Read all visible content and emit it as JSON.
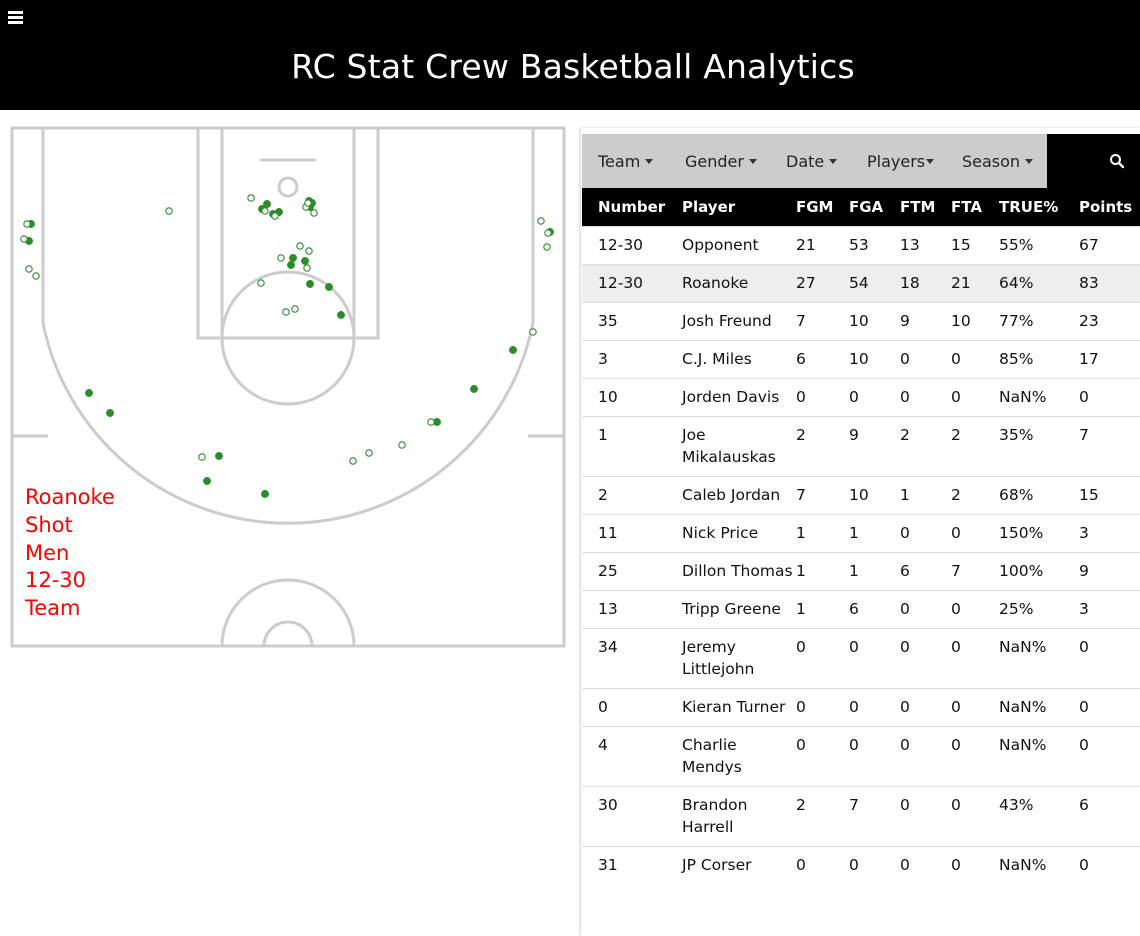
{
  "header": {
    "title": "RC Stat Crew Basketball Analytics",
    "menu_icon": "hamburger-icon"
  },
  "court": {
    "label_lines": [
      "Roanoke",
      "Shot",
      "Men",
      "12-30",
      "Team"
    ],
    "label_color": "#ff0000",
    "shot_color": "#2a8c2a",
    "line_color": "#cccccc"
  },
  "filters": {
    "items": [
      {
        "label": "Team"
      },
      {
        "label": "Gender"
      },
      {
        "label": "Date"
      },
      {
        "label": "Players"
      },
      {
        "label": "Season"
      }
    ],
    "search_icon": "search-icon"
  },
  "table": {
    "columns": [
      "Number",
      "Player",
      "FGM",
      "FGA",
      "FTM",
      "FTA",
      "TRUE%",
      "Points"
    ],
    "rows": [
      [
        "12-30",
        "Opponent",
        "21",
        "53",
        "13",
        "15",
        "55%",
        "67"
      ],
      [
        "12-30",
        "Roanoke",
        "27",
        "54",
        "18",
        "21",
        "64%",
        "83"
      ],
      [
        "35",
        "Josh Freund",
        "7",
        "10",
        "9",
        "10",
        "77%",
        "23"
      ],
      [
        "3",
        "C.J. Miles",
        "6",
        "10",
        "0",
        "0",
        "85%",
        "17"
      ],
      [
        "10",
        "Jorden Davis",
        "0",
        "0",
        "0",
        "0",
        "NaN%",
        "0"
      ],
      [
        "1",
        "Joe Mikalauskas",
        "2",
        "9",
        "2",
        "2",
        "35%",
        "7"
      ],
      [
        "2",
        "Caleb Jordan",
        "7",
        "10",
        "1",
        "2",
        "68%",
        "15"
      ],
      [
        "11",
        "Nick Price",
        "1",
        "1",
        "0",
        "0",
        "150%",
        "3"
      ],
      [
        "25",
        "Dillon Thomas",
        "1",
        "1",
        "6",
        "7",
        "100%",
        "9"
      ],
      [
        "13",
        "Tripp Greene",
        "1",
        "6",
        "0",
        "0",
        "25%",
        "3"
      ],
      [
        "34",
        "Jeremy Littlejohn",
        "0",
        "0",
        "0",
        "0",
        "NaN%",
        "0"
      ],
      [
        "0",
        "Kieran Turner",
        "0",
        "0",
        "0",
        "0",
        "NaN%",
        "0"
      ],
      [
        "4",
        "Charlie Mendys",
        "0",
        "0",
        "0",
        "0",
        "NaN%",
        "0"
      ],
      [
        "30",
        "Brandon Harrell",
        "2",
        "7",
        "0",
        "0",
        "43%",
        "6"
      ],
      [
        "31",
        "JP Corser",
        "0",
        "0",
        "0",
        "0",
        "NaN%",
        "0"
      ]
    ]
  }
}
